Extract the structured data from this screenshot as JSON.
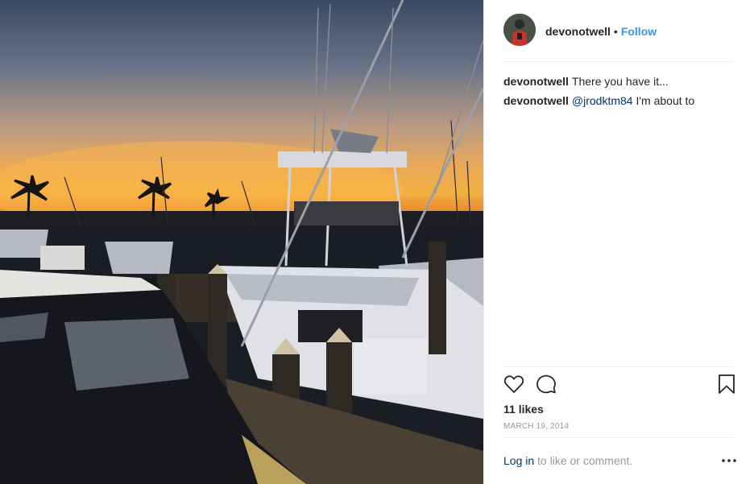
{
  "post": {
    "photo_alt": "",
    "header": {
      "username": "devonotwell",
      "separator": "•",
      "follow_label": "Follow"
    },
    "comments": [
      {
        "username": "devonotwell",
        "mention": "",
        "text": "There you have it..."
      },
      {
        "username": "devonotwell",
        "mention": "@jrodktm84",
        "text": "I'm about to"
      }
    ],
    "actions": {
      "like_icon": "heart-icon",
      "comment_icon": "comment-icon",
      "save_icon": "bookmark-icon"
    },
    "likes_text": "11 likes",
    "date_text": "MARCH 19, 2014",
    "footer": {
      "login_label": "Log in",
      "login_suffix": "to like or comment.",
      "more_icon": "more-options-icon"
    },
    "colors": {
      "link_blue": "#3897f0",
      "mention_blue": "#003569",
      "muted_gray": "#999999",
      "text_dark": "#262626",
      "divider": "#efefef"
    }
  }
}
